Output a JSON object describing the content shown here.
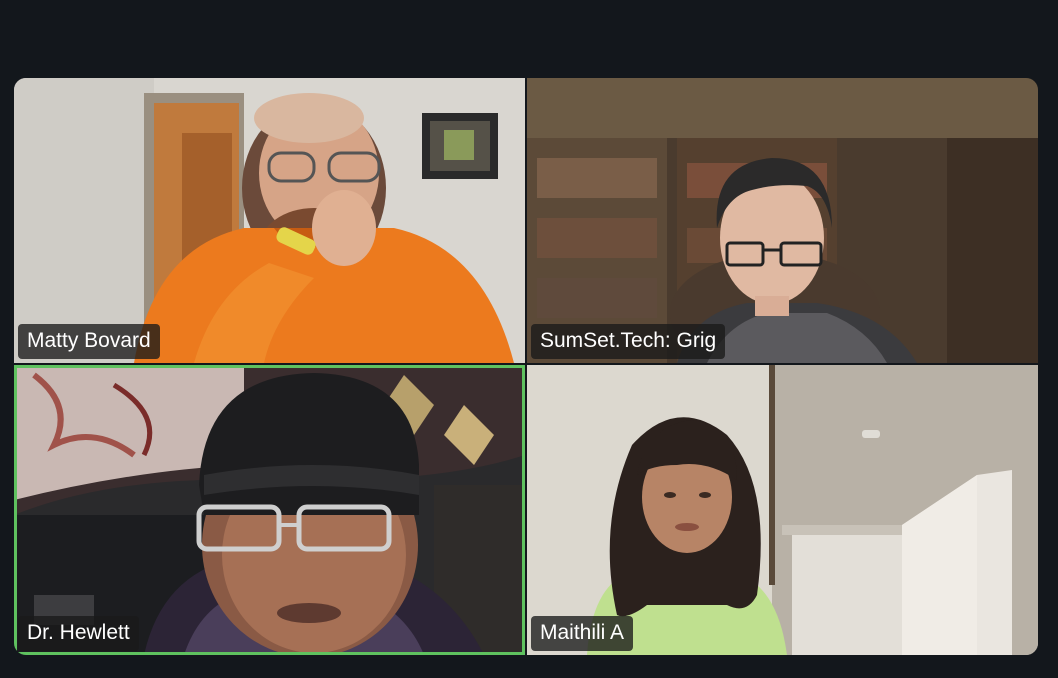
{
  "meeting": {
    "participants": [
      {
        "name": "Matty Bovard",
        "speaking": false
      },
      {
        "name": "SumSet.Tech: Grig",
        "speaking": false
      },
      {
        "name": "Dr. Hewlett",
        "speaking": true
      },
      {
        "name": "Maithili A",
        "speaking": false
      }
    ],
    "colors": {
      "background": "#13171c",
      "active_speaker_border": "#5fc25f",
      "name_tag_background": "#1a1a1a",
      "name_tag_text": "#ffffff"
    }
  }
}
